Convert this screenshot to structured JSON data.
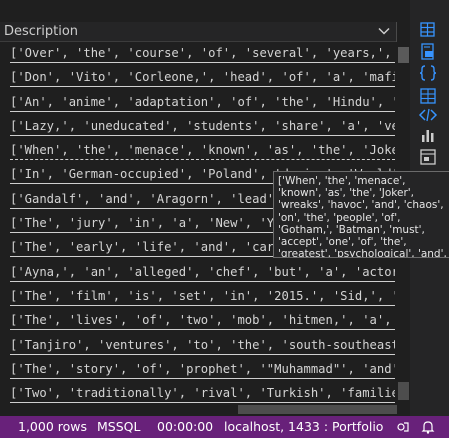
{
  "grid": {
    "column_header": "Description",
    "rows": [
      "['Over', 'the', 'course', 'of', 'several', 'years,', 'two', 'convicts'",
      "['Don', 'Vito', 'Corleone,', 'head', 'of', 'a', 'mafia', 'family,'",
      "['An', 'anime', 'adaptation', 'of', 'the', 'Hindu', 'epic'",
      "['Lazy,', 'uneducated', 'students', 'share', 'a', 'very', 'close'",
      "['When', 'the', 'menace', 'known', 'as', 'the', 'Joker', 'wreaks'",
      "['In', 'German-occupied', 'Poland', 'during', 'World', 'War', 'II,'",
      "['Gandalf', 'and', 'Aragorn', 'lead', 'the', 'World', 'of', 'Men'",
      "['The', 'jury', 'in', 'a', 'New', 'York', 'murder', 'trial'",
      "['The', 'early', 'life', 'and', 'career', 'of', 'Vito', 'Corleone'",
      "['Ayna,', 'an', 'alleged', 'chef', 'but', 'a', 'actor', 'in'",
      "['The', 'film', 'is', 'set', 'in', '2015.', 'Sid,', 'is', 'the'",
      "['The', 'lives', 'of', 'two', 'mob', 'hitmen,', 'a', 'boxer,'",
      "['Tanjiro', 'ventures', 'to', 'the', 'south-southeast', 'where'",
      "['The', 'story', 'of', 'prophet', '\"Muhammad\"', 'and', 'the'",
      "['Two', 'traditionally', 'rival', 'Turkish', 'families', 'are'"
    ]
  },
  "tooltip": {
    "text": "['When', 'the', 'menace', 'known', 'as', 'the', 'Joker', 'wreaks', 'havoc', 'and', 'chaos', 'on', 'the', 'people', 'of', 'Gotham,', 'Batman', 'must', 'accept', 'one', 'of', 'the', 'greatest', 'psychological', 'and', 'physical', 'tests', 'of', 'his', ..."
  },
  "sidebar": {
    "icons": [
      "results-grid-icon",
      "save-as-csv-icon",
      "save-as-json-icon",
      "save-as-excel-icon",
      "save-as-xml-icon",
      "chart-icon",
      "visualizer-icon"
    ]
  },
  "status": {
    "rows": "1,000 rows",
    "provider": "MSSQL",
    "elapsed": "00:00:00",
    "connection": "localhost, 1433 : Portfolio"
  },
  "colors": {
    "status_bg": "#68217a",
    "grid_bg": "#1f1f1f",
    "sidebar_icon": "#3794ff"
  }
}
